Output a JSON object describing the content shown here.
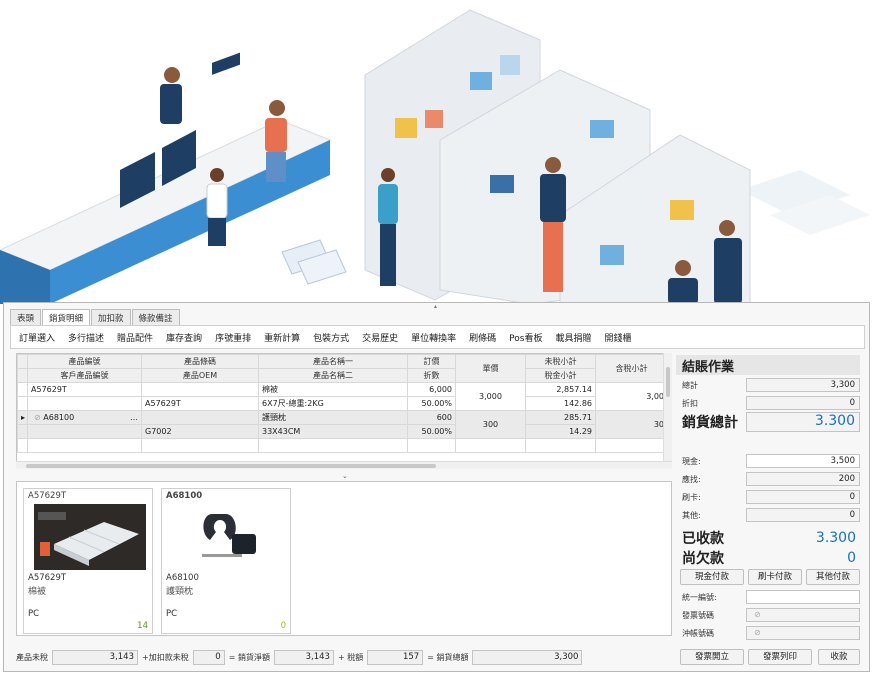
{
  "tabs": [
    "表頭",
    "銷貨明細",
    "加扣款",
    "條款備註"
  ],
  "active_tab": 1,
  "toolbar": [
    "訂單選入",
    "多行描述",
    "贈品配件",
    "庫存查詢",
    "序號重排",
    "重新計算",
    "包裝方式",
    "交易歷史",
    "單位轉換率",
    "刷條碼",
    "Pos看板",
    "載具捐贈",
    "開錢櫃"
  ],
  "grid": {
    "header1": [
      "產品編號",
      "產品條碼",
      "產品名稱一",
      "訂價",
      "單價",
      "未稅小計",
      "含稅小計"
    ],
    "header2": [
      "客戶產品編號",
      "產品OEM",
      "產品名稱二",
      "折數",
      "",
      "稅金小計",
      ""
    ],
    "rows": [
      {
        "code": "A57629T",
        "cust_code": "",
        "barcode": "",
        "oem": "A57629T",
        "name1": "棉被",
        "name2": "6X7尺-總重:2KG",
        "price": "6,000",
        "discount": "50.00%",
        "unit_price": "3,000",
        "subtotal": "2,857.14",
        "tax": "142.86",
        "tax_total": "3,00"
      },
      {
        "code": "A68100",
        "cust_code": "",
        "barcode": "",
        "oem": "G7002",
        "name1": "護頸枕",
        "name2": "33X43CM",
        "price": "600",
        "discount": "50.00%",
        "unit_price": "300",
        "subtotal": "285.71",
        "tax": "14.29",
        "tax_total": "30"
      }
    ],
    "ellipsis": "…"
  },
  "splitter": "⌄",
  "cards": [
    {
      "code": "A57629T",
      "line1": "A57629T",
      "line2": "棉被",
      "unit": "PC",
      "qty": "14",
      "bold": false
    },
    {
      "code": "A68100",
      "line1": "A68100",
      "line2": "護頸枕",
      "unit": "PC",
      "qty": "0",
      "bold": true
    }
  ],
  "summary": {
    "net_label": "產品未稅",
    "net": "3,143",
    "deduct_label": "+加扣款未稅",
    "deduct": "0",
    "sales_net_label": "= 銷貨淨額",
    "sales_net": "3,143",
    "tax_label": "+ 稅額",
    "tax": "157",
    "total_label": "= 銷貨總額",
    "total": "3,300"
  },
  "settle": {
    "title": "結賬作業",
    "total_label": "總計",
    "total": "3,300",
    "discount_label": "折扣",
    "discount": "0",
    "sales_total_label": "銷貨總計",
    "sales_total": "3.300",
    "cash_label": "現金:",
    "cash": "3,500",
    "change_label": "應找:",
    "change": "200",
    "card_label": "刷卡:",
    "card": "0",
    "other_label": "其他:",
    "other": "0",
    "received_label": "已收款",
    "received": "3.300",
    "owed_label": "尚欠款",
    "owed": "0",
    "buttons": [
      "現金付款",
      "刷卡付款",
      "其他付款"
    ],
    "tax_id_label": "統一編號:",
    "invoice_label": "發票號碼",
    "credit_label": "沖帳號碼",
    "bottom_buttons": [
      "發票開立",
      "發票列印",
      "收款"
    ]
  }
}
